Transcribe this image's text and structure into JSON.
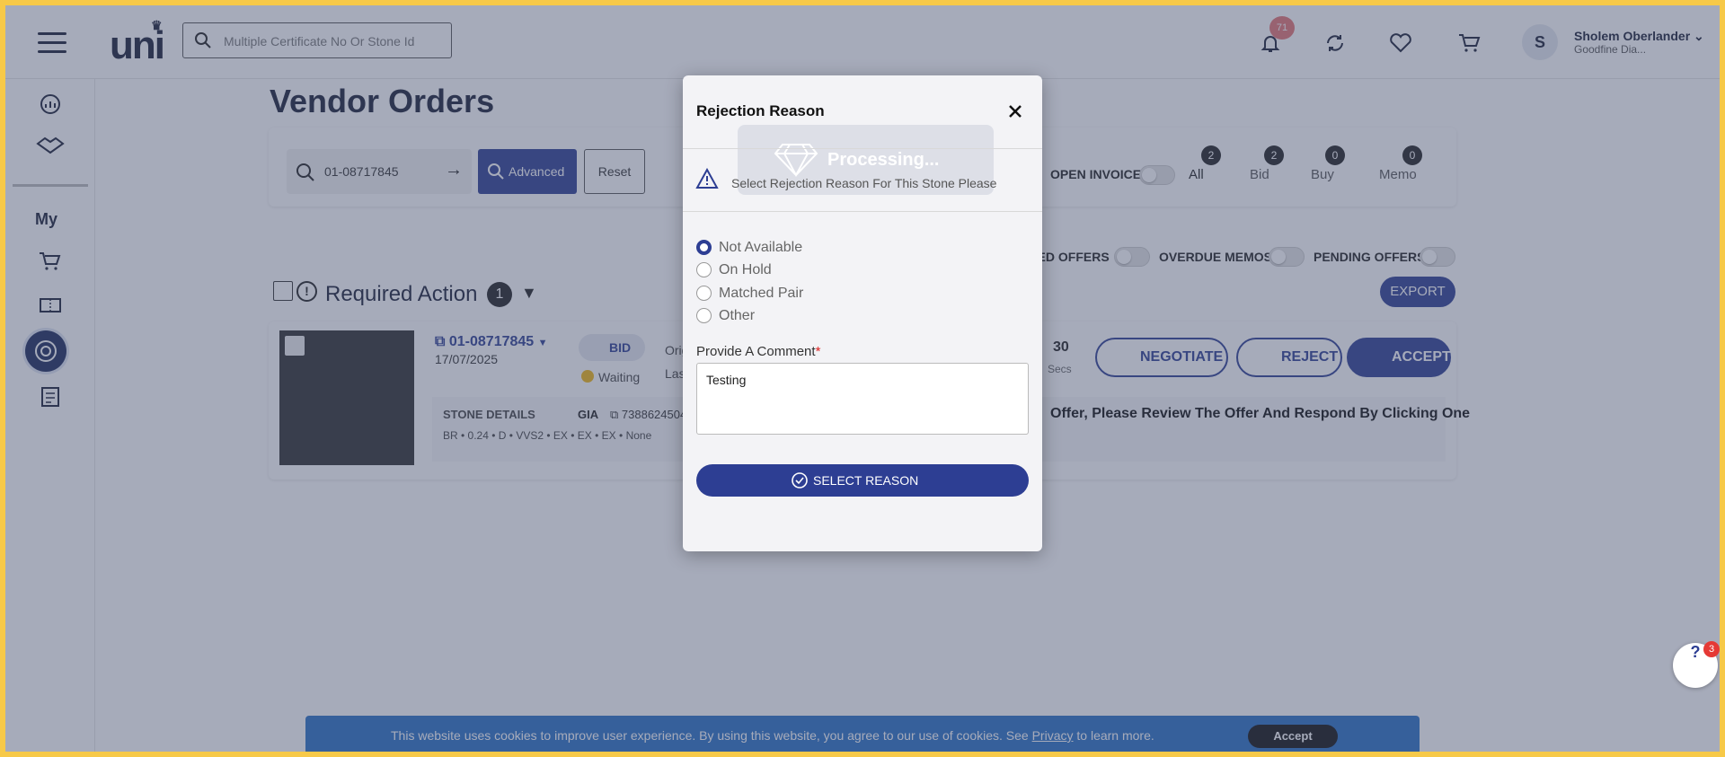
{
  "header": {
    "logo": "uni",
    "search_placeholder": "Multiple Certificate No Or Stone Id",
    "notifications_count": "71",
    "user_initial": "S",
    "user_name": "Sholem Oberlander",
    "user_company": "Goodfine Dia..."
  },
  "sidebar": {
    "my_label": "My"
  },
  "page": {
    "title": "Vendor Orders",
    "order_search_value": "01-08717845",
    "advanced_label": "Advanced",
    "reset_label": "Reset",
    "open_invoice_label": "OPEN INVOICE",
    "tabs": [
      {
        "label": "All",
        "count": "2"
      },
      {
        "label": "Bid",
        "count": "2"
      },
      {
        "label": "Buy",
        "count": "0"
      },
      {
        "label": "Memo",
        "count": "0"
      }
    ],
    "filters": [
      "TED OFFERS",
      "OVERDUE MEMOS",
      "PENDING OFFERS"
    ],
    "required_action_label": "Required Action",
    "required_action_count": "1",
    "export_label": "EXPORT"
  },
  "order": {
    "id": "01-08717845",
    "date": "17/07/2025",
    "type": "BID",
    "status": "Waiting",
    "orig_label": "Orig",
    "last_label": "Las",
    "timer_value": "30",
    "timer_unit": "Secs",
    "negotiate_label": "NEGOTIATE",
    "reject_label": "REJECT",
    "accept_label": "ACCEPT",
    "stone_details_label": "STONE DETAILS",
    "lab": "GIA",
    "cert_no": "7388624504",
    "specs": [
      "BR",
      "0.24",
      "D",
      "VVS2",
      "EX",
      "EX",
      "EX",
      "None"
    ],
    "message": "Offer, Please Review The Offer And Respond By Clicking One"
  },
  "cookie": {
    "text_before": "This website uses cookies to improve user experience. By using this website, you agree to our use of cookies. See",
    "link": "Privacy",
    "text_after": "to learn more.",
    "accept": "Accept"
  },
  "help": {
    "label": "?",
    "badge": "3"
  },
  "modal": {
    "title": "Rejection Reason",
    "processing": "Processing...",
    "warning": "Select Rejection Reason For This Stone Please",
    "options": [
      "Not Available",
      "On Hold",
      "Matched Pair",
      "Other"
    ],
    "selected": "Not Available",
    "comment_label": "Provide A Comment",
    "required_mark": "*",
    "comment_value": "Testing",
    "submit_label": "SELECT REASON"
  },
  "colors": {
    "primary": "#2d3e93",
    "frame": "#f7c948",
    "dark": "#1a1f36"
  }
}
